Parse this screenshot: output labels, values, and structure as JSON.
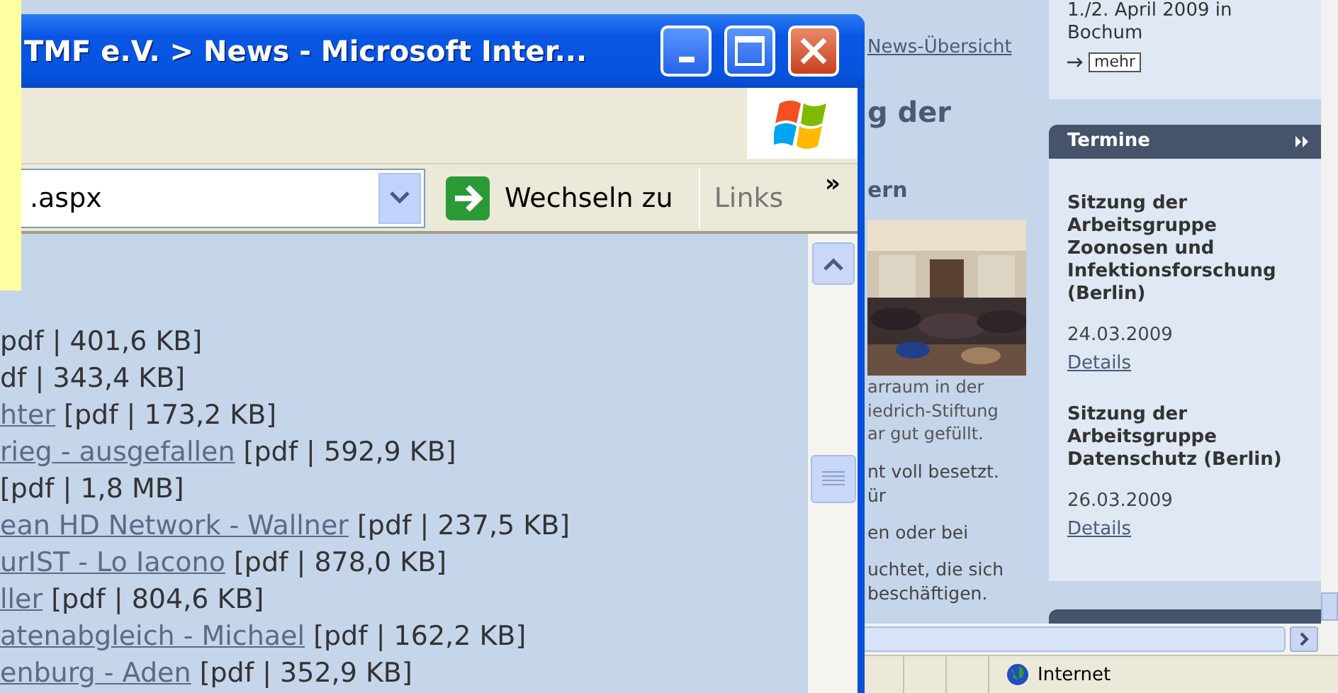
{
  "browser_window": {
    "title": "TMF e.V. > News - Microsoft Inter...",
    "address": ".aspx",
    "go_button": "Wechseln zu",
    "links_label": "Links",
    "chevron": "»",
    "documents": [
      {
        "info": "pdf | 401,6 KB]"
      },
      {
        "info": "df | 343,4 KB]"
      },
      {
        "link": "hter",
        "info": "[pdf | 173,2 KB]"
      },
      {
        "link": "rieg - ausgefallen",
        "info": "[pdf | 592,9 KB]"
      },
      {
        "info": "[pdf | 1,8 MB]"
      },
      {
        "link": "ean HD Network - Wallner",
        "info": "[pdf | 237,5 KB]"
      },
      {
        "link": "urIST - Lo Iacono",
        "info": "[pdf | 878,0 KB]"
      },
      {
        "link": "ller",
        "info": "[pdf | 804,6 KB]"
      },
      {
        "link": "atenabgleich - Michael",
        "info": "[pdf | 162,2 KB]"
      },
      {
        "link": "enburg - Aden",
        "info": "[pdf | 352,9 KB]"
      }
    ]
  },
  "background_page": {
    "back_link": "News-Übersicht",
    "heading": "g der",
    "subheading": "ern",
    "photo": {
      "kind": "picture"
    },
    "caption_lines": [
      "arraum in der",
      "iedrich-Stiftung",
      "ar gut gefüllt."
    ],
    "paragraphs": [
      [
        "nt voll besetzt.",
        "ür"
      ],
      [
        "en oder bei"
      ],
      [
        "uchtet, die sich",
        "beschäftigen."
      ]
    ],
    "sidebar": {
      "event_lines": [
        "1./2. April 2009 in",
        "Bochum"
      ],
      "more_button": "mehr",
      "termine": {
        "title": "Termine",
        "entries": [
          {
            "title": "Sitzung der Arbeitsgruppe Zoonosen und Infektionsforschung (Berlin)",
            "date": "24.03.2009",
            "link": "Details"
          },
          {
            "title": "Sitzung der Arbeitsgruppe Datenschutz (Berlin)",
            "date": "26.03.2009",
            "link": "Details"
          }
        ]
      }
    },
    "status_bar": {
      "zone": "Internet"
    }
  }
}
